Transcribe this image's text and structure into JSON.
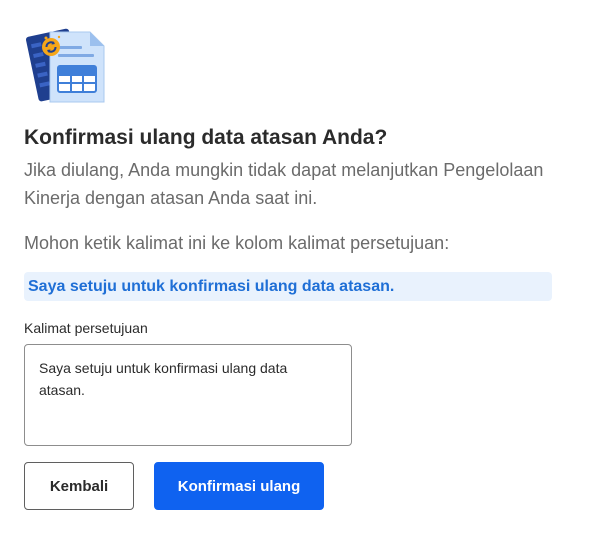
{
  "illustration": {
    "icon": "spreadsheet-refresh-illustration",
    "colors": {
      "back_sheet": "#1f3f8f",
      "front_sheet": "#cfe3fb",
      "table": "#3f7fd9",
      "badge": "#f6a619"
    }
  },
  "dialog": {
    "title": "Konfirmasi ulang data atasan Anda?",
    "description": "Jika diulang, Anda mungkin tidak dapat melanjutkan Pengelolaan Kinerja dengan atasan Anda saat ini.",
    "instruction": "Mohon ketik kalimat ini ke kolom kalimat persetujuan:",
    "phrase": "Saya setuju untuk konfirmasi ulang data atasan."
  },
  "form": {
    "field_label": "Kalimat persetujuan",
    "field_value": "Saya setuju untuk konfirmasi ulang data atasan."
  },
  "buttons": {
    "back_label": "Kembali",
    "confirm_label": "Konfirmasi ulang"
  },
  "colors": {
    "primary": "#0f62f0",
    "phrase_background": "#e9f2fd",
    "phrase_text": "#1f6fd6"
  }
}
